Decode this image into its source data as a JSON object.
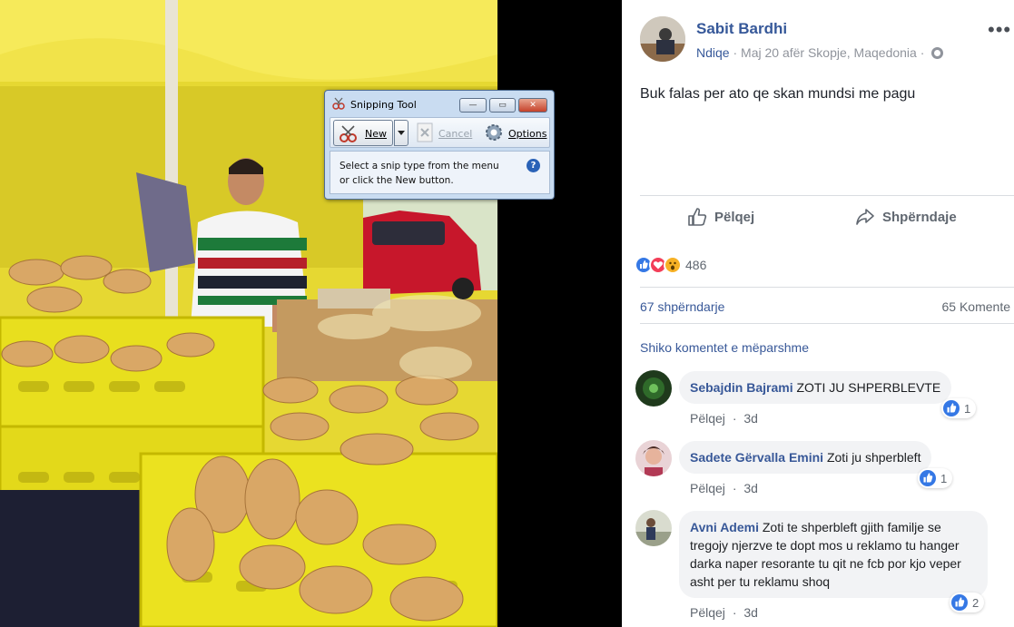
{
  "snipping_tool": {
    "title": "Snipping Tool",
    "new_label": "New",
    "cancel_label": "Cancel",
    "options_label": "Options",
    "message_line1": "Select a snip type from the menu",
    "message_line2": "or click the New button."
  },
  "post": {
    "author": "Sabit Bardhi",
    "feeling": "Ndiqe",
    "meta_text": "· Maj 20 afër Skopje, Maqedonia ·",
    "text": "Buk falas per ato qe skan mundsi me pagu",
    "like_label": "Pëlqej",
    "share_label": "Shpërndaje",
    "reaction_count": "486",
    "shares_text": "67 shpërndarje",
    "comments_text": "65 Komente",
    "previous_comments": "Shiko komentet e mëparshme"
  },
  "comments": [
    {
      "name": "Sebajdin Bajrami",
      "text": "ZOTI JU SHPERBLEVTE",
      "likes": "1",
      "like_label": "Pëlqej",
      "time": "3d"
    },
    {
      "name": "Sadete Gërvalla Emini",
      "text": "Zoti ju shperbleft",
      "likes": "1",
      "like_label": "Pëlqej",
      "time": "3d"
    },
    {
      "name": "Avni Ademi",
      "text": "Zoti te shperbleft gjith familje se tregojy njerzve te dopt mos u reklamo tu hanger darka naper resorante tu qit ne fcb por kjo veper asht per tu reklamu shoq",
      "likes": "2",
      "like_label": "Pëlqej",
      "time": "3d"
    }
  ],
  "colors": {
    "link_blue": "#365899",
    "like_blue": "#3578e5",
    "love_red": "#f33e58",
    "wow_yellow": "#f7b125"
  }
}
